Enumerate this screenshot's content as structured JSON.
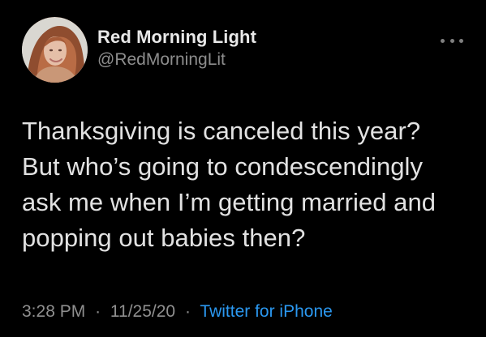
{
  "user": {
    "display_name": "Red Morning Light",
    "handle": "@RedMorningLit",
    "avatar_icon": "profile-photo"
  },
  "tweet": {
    "text": "Thanksgiving is canceled this year?\nBut who’s going to condescendingly\nask me when I’m getting married and\npopping out babies then?",
    "time": "3:28 PM",
    "date": "11/25/20",
    "separator": "·",
    "source": "Twitter for iPhone"
  },
  "icons": {
    "more": "more-icon"
  },
  "colors": {
    "background": "#000000",
    "primary_text": "#e2e2e2",
    "secondary_text": "#8f8f8f",
    "link": "#2b98f0"
  }
}
